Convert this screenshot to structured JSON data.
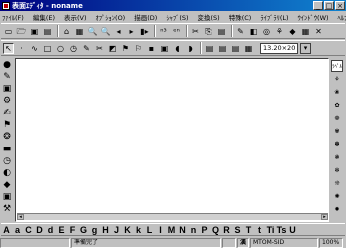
{
  "window": {
    "title": "表面ｴﾃﾞｨﾀ - noname",
    "buttons": [
      "_",
      "□",
      "×"
    ]
  },
  "menu": [
    "ﾌｧｲﾙ(F)",
    "編集(E)",
    "表示(V)",
    "ｵﾌﾟｼｮﾝ(O)",
    "描画(D)",
    "ｼｬﾌﾞ(S)",
    "変換(S)",
    "特殊(C)",
    "ﾗｲﾌﾞﾗﾘ(L)",
    "ｳｲﾝﾄﾞｳ(W)",
    "ﾍﾙﾌﾟ(H)"
  ],
  "toolbar1": {
    "icons": [
      "▭",
      "🗁",
      "▣",
      "▤",
      "⌂",
      "▦",
      "🔍",
      "🔍",
      "◂",
      "▸",
      "▮▸",
      "ⁿ³",
      "ᵉⁿ",
      "✂",
      "⎘",
      "▤",
      "✎",
      "◧",
      "◎",
      "⚘",
      "◆",
      "▦",
      "✕"
    ]
  },
  "toolbar2": {
    "icons": [
      "↖",
      "·",
      "∿",
      "□",
      "○",
      "◷",
      "✎",
      "✂",
      "◩",
      "⚑",
      "⚐",
      "▪",
      "▣",
      "◖",
      "◗",
      "▤",
      "▤",
      "▤",
      "▦"
    ],
    "size_value": "13.20×20",
    "size_button": "▾"
  },
  "left_palette": [
    "●",
    "✎",
    "▣",
    "⚙",
    "✍",
    "⚑",
    "❂",
    "▬",
    "◷",
    "◐",
    "◆",
    "▣",
    "⚒",
    "▦"
  ],
  "right_palette": [
    "ﾗﾍﾟﾙ",
    "⚘",
    "❀",
    "✿",
    "❁",
    "✾",
    "✽",
    "❃",
    "✻",
    "❊",
    "✺",
    "✹",
    "❋",
    "❈",
    "▮",
    "ǁ"
  ],
  "glyph_bar": [
    "A",
    "a",
    "C",
    "D",
    "d",
    "E",
    "F",
    "G",
    "g",
    "H",
    "J",
    "K",
    "k",
    "L",
    "I",
    "M",
    "N",
    "n",
    "P",
    "Q",
    "R",
    "S",
    "T",
    "t",
    "Ti",
    "Ts",
    "U"
  ],
  "status": {
    "pane1": "",
    "message": "準備完了",
    "pane3": "",
    "input_mode_label": "漢",
    "font_name": "MTOM-SID",
    "zoom": "100%"
  }
}
